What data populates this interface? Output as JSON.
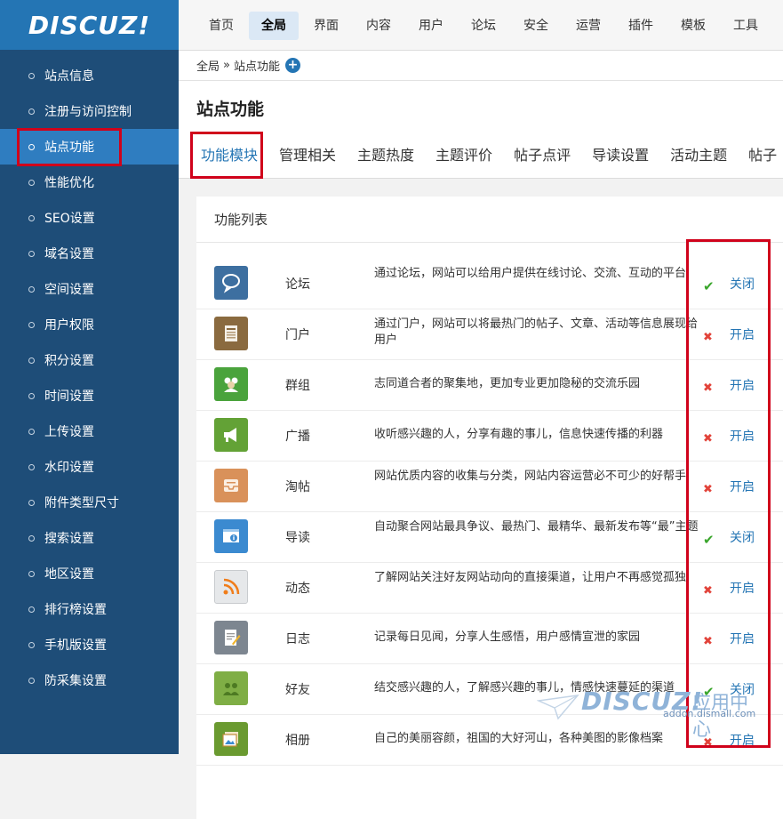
{
  "logo": "DISCUZ!",
  "sidebar": {
    "items": [
      {
        "label": "站点信息"
      },
      {
        "label": "注册与访问控制"
      },
      {
        "label": "站点功能"
      },
      {
        "label": "性能优化"
      },
      {
        "label": "SEO设置"
      },
      {
        "label": "域名设置"
      },
      {
        "label": "空间设置"
      },
      {
        "label": "用户权限"
      },
      {
        "label": "积分设置"
      },
      {
        "label": "时间设置"
      },
      {
        "label": "上传设置"
      },
      {
        "label": "水印设置"
      },
      {
        "label": "附件类型尺寸"
      },
      {
        "label": "搜索设置"
      },
      {
        "label": "地区设置"
      },
      {
        "label": "排行榜设置"
      },
      {
        "label": "手机版设置"
      },
      {
        "label": "防采集设置"
      }
    ]
  },
  "topnav": {
    "items": [
      {
        "label": "首页"
      },
      {
        "label": "全局"
      },
      {
        "label": "界面"
      },
      {
        "label": "内容"
      },
      {
        "label": "用户"
      },
      {
        "label": "论坛"
      },
      {
        "label": "安全"
      },
      {
        "label": "运营"
      },
      {
        "label": "插件"
      },
      {
        "label": "模板"
      },
      {
        "label": "工具"
      }
    ]
  },
  "breadcrumb": {
    "root": "全局",
    "sep": "»",
    "current": "站点功能",
    "plus": "+"
  },
  "page_title": "站点功能",
  "tabs": [
    {
      "label": "功能模块"
    },
    {
      "label": "管理相关"
    },
    {
      "label": "主题热度"
    },
    {
      "label": "主题评价"
    },
    {
      "label": "帖子点评"
    },
    {
      "label": "导读设置"
    },
    {
      "label": "活动主题"
    },
    {
      "label": "帖子"
    }
  ],
  "panel_title": "功能列表",
  "features": [
    {
      "name": "论坛",
      "desc": "通过论坛，网站可以给用户提供在线讨论、交流、互动的平台",
      "status": "✔",
      "action": "关闭",
      "icon": "speech-bubble-icon"
    },
    {
      "name": "门户",
      "desc": "通过门户，网站可以将最热门的帖子、文章、活动等信息展现给用户",
      "status": "✖",
      "action": "开启",
      "icon": "newspaper-icon"
    },
    {
      "name": "群组",
      "desc": "志同道合者的聚集地，更加专业更加隐秘的交流乐园",
      "status": "✖",
      "action": "开启",
      "icon": "group-icon"
    },
    {
      "name": "广播",
      "desc": "收听感兴趣的人，分享有趣的事儿，信息快速传播的利器",
      "status": "✖",
      "action": "开启",
      "icon": "megaphone-icon"
    },
    {
      "name": "淘帖",
      "desc": "网站优质内容的收集与分类，网站内容运营必不可少的好帮手",
      "status": "✖",
      "action": "开启",
      "icon": "inbox-icon"
    },
    {
      "name": "导读",
      "desc": "自动聚合网站最具争议、最热门、最精华、最新发布等“最”主题",
      "status": "✔",
      "action": "关闭",
      "icon": "info-window-icon"
    },
    {
      "name": "动态",
      "desc": "了解网站关注好友网站动向的直接渠道，让用户不再感觉孤独",
      "status": "✖",
      "action": "开启",
      "icon": "rss-icon"
    },
    {
      "name": "日志",
      "desc": "记录每日见闻，分享人生感悟，用户感情宣泄的家园",
      "status": "✖",
      "action": "开启",
      "icon": "notepad-icon"
    },
    {
      "name": "好友",
      "desc": "结交感兴趣的人，了解感兴趣的事儿，情感快速蔓延的渠道",
      "status": "✔",
      "action": "关闭",
      "icon": "friends-icon"
    },
    {
      "name": "相册",
      "desc": "自己的美丽容颜，祖国的大好河山，各种美图的影像档案",
      "status": "✖",
      "action": "开启",
      "icon": "photo-album-icon"
    }
  ],
  "watermark": {
    "logo": "DISCUZ!",
    "cn": "应用中心",
    "url": "addon.dismall.com"
  },
  "colors": {
    "sidebar": "#1e4d78",
    "sidebar_active": "#2f7dc0",
    "accent": "#2475b4",
    "highlight_box": "#d0021b",
    "on": "#3aa62c",
    "off": "#e2433a"
  }
}
